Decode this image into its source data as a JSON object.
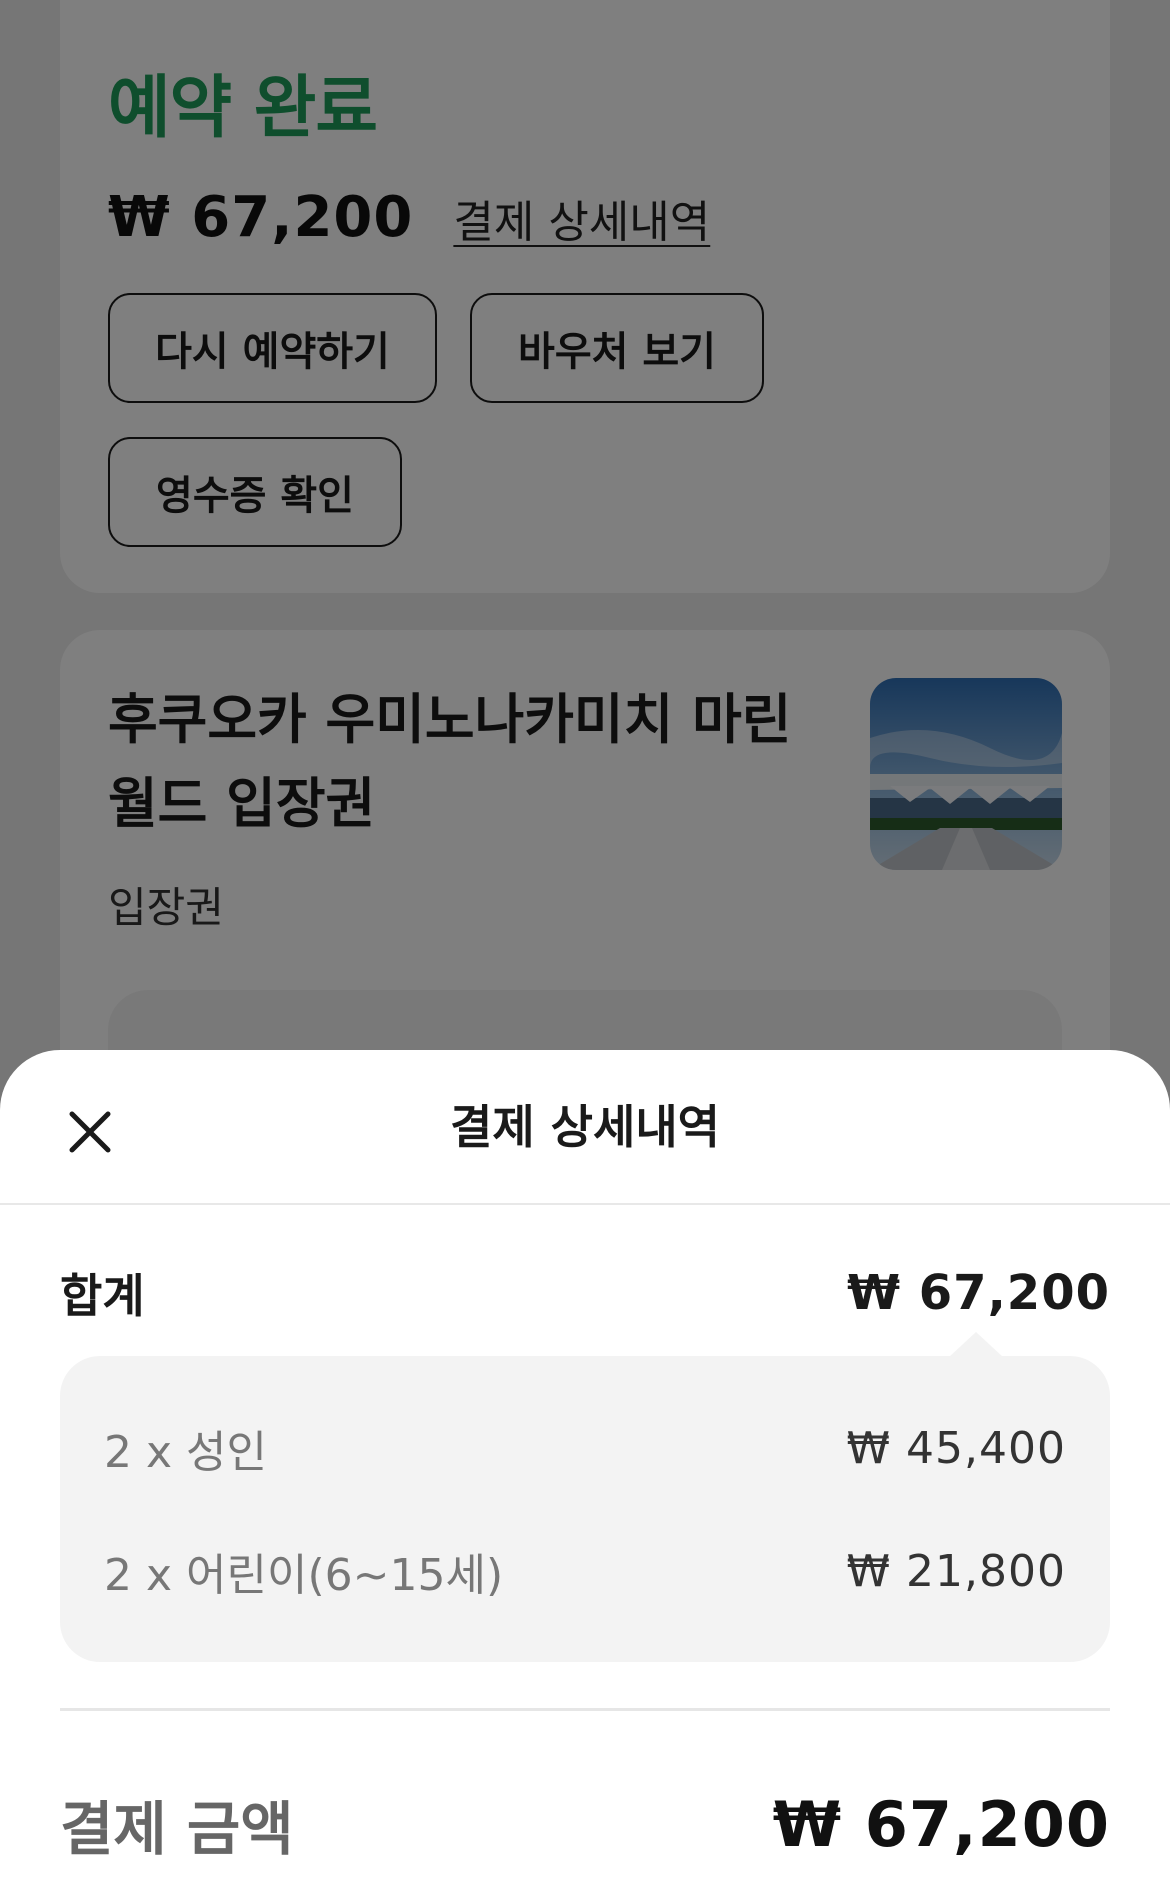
{
  "status_card": {
    "title": "예약 완료",
    "price": "₩ 67,200",
    "detail_link": "결제 상세내역",
    "buttons": {
      "rebook": "다시 예약하기",
      "voucher": "바우처 보기",
      "receipt": "영수증 확인"
    }
  },
  "product_card": {
    "title": "후쿠오카 우미노나카미치 마린 월드 입장권",
    "subtitle": "입장권",
    "image_alt": "marine-world-entrance-photo"
  },
  "sheet": {
    "title": "결제 상세내역",
    "close_icon": "close-icon",
    "total_label": "합계",
    "total_value": "₩ 67,200",
    "items": [
      {
        "label": "2 x 성인",
        "value": "₩ 45,400"
      },
      {
        "label": "2 x 어린이(6~15세)",
        "value": "₩ 21,800"
      }
    ],
    "payment_label": "결제 금액",
    "payment_value": "₩ 67,200"
  },
  "colors": {
    "accent_green": "#1f9d5b",
    "overlay": "rgba(0,0,0,0.5)"
  }
}
